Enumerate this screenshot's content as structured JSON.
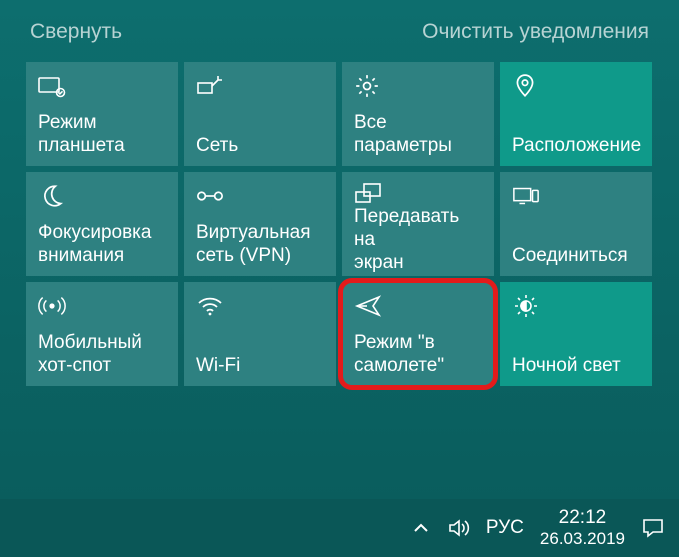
{
  "header": {
    "collapse": "Свернуть",
    "clear": "Очистить уведомления"
  },
  "tiles": [
    {
      "icon": "tablet-icon",
      "label": "Режим\nпланшета"
    },
    {
      "icon": "network-icon",
      "label": "Сеть"
    },
    {
      "icon": "settings-icon",
      "label": "Все параметры"
    },
    {
      "icon": "location-icon",
      "label": "Расположение",
      "active": true
    },
    {
      "icon": "moon-icon",
      "label": "Фокусировка\nвнимания"
    },
    {
      "icon": "vpn-icon",
      "label": "Виртуальная\nсеть (VPN)"
    },
    {
      "icon": "project-icon",
      "label": "Передавать на\nэкран"
    },
    {
      "icon": "connect-icon",
      "label": "Соединиться"
    },
    {
      "icon": "hotspot-icon",
      "label": "Мобильный\nхот-спот"
    },
    {
      "icon": "wifi-icon",
      "label": "Wi-Fi"
    },
    {
      "icon": "airplane-icon",
      "label": "Режим \"в\nсамолете\"",
      "highlight": true
    },
    {
      "icon": "nightlight-icon",
      "label": "Ночной свет",
      "active": true
    }
  ],
  "taskbar": {
    "lang": "РУС",
    "time": "22:12",
    "date": "26.03.2019"
  }
}
